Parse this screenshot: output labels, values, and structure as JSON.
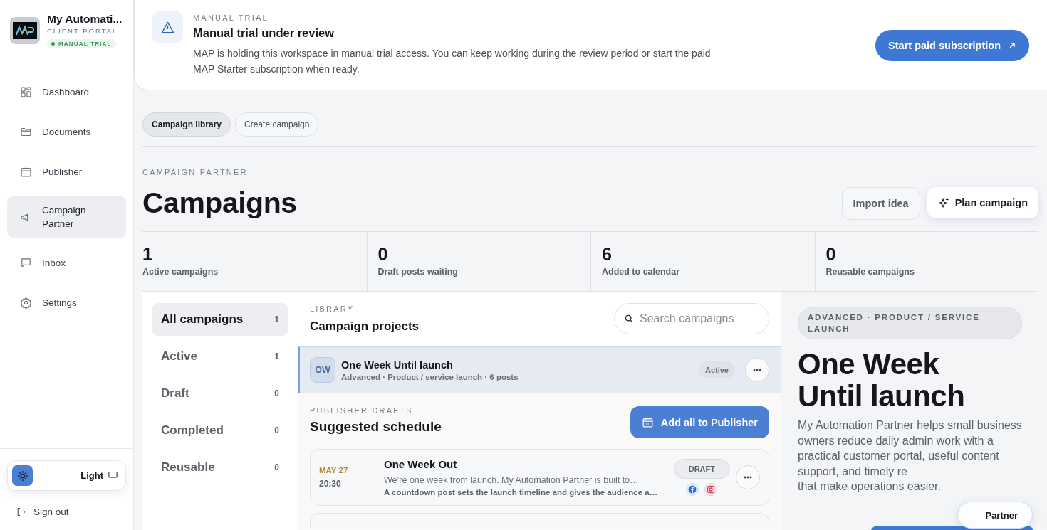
{
  "sidebar": {
    "brand": {
      "name": "My Automati...",
      "subtitle": "CLIENT PORTAL",
      "badge": "MANUAL TRIAL"
    },
    "nav": [
      {
        "label": "Dashboard",
        "selected": false
      },
      {
        "label": "Documents",
        "selected": false
      },
      {
        "label": "Publisher",
        "selected": false
      },
      {
        "label": "Campaign Partner",
        "selected": true
      },
      {
        "label": "Inbox",
        "selected": false
      },
      {
        "label": "Settings",
        "selected": false
      }
    ],
    "theme": {
      "label": "Light"
    },
    "sign_out": "Sign out"
  },
  "banner": {
    "eyebrow": "MANUAL TRIAL",
    "title": "Manual trial under review",
    "text": "MAP is holding this workspace in manual trial access. You can keep working during the review period or start the paid MAP Starter subscription when ready.",
    "button": "Start paid subscription"
  },
  "tabs": [
    {
      "label": "Campaign library",
      "selected": true
    },
    {
      "label": "Create campaign",
      "selected": false
    }
  ],
  "header": {
    "eyebrow": "CAMPAIGN PARTNER",
    "title": "Campaigns",
    "buttons": [
      {
        "label": "Import idea",
        "kind": "secondary"
      },
      {
        "label": "Plan campaign",
        "kind": "sparkle"
      }
    ]
  },
  "stats": [
    {
      "value": "1",
      "label": "Active campaigns"
    },
    {
      "value": "0",
      "label": "Draft posts waiting"
    },
    {
      "value": "6",
      "label": "Added to calendar"
    },
    {
      "value": "0",
      "label": "Reusable campaigns"
    }
  ],
  "filters": [
    {
      "label": "All campaigns",
      "count": "1",
      "selected": true
    },
    {
      "label": "Active",
      "count": "1",
      "selected": false
    },
    {
      "label": "Draft",
      "count": "0",
      "selected": false
    },
    {
      "label": "Completed",
      "count": "0",
      "selected": false
    },
    {
      "label": "Reusable",
      "count": "0",
      "selected": false
    }
  ],
  "library": {
    "eyebrow": "LIBRARY",
    "title": "Campaign projects",
    "search_placeholder": "Search campaigns",
    "projects": [
      {
        "initials": "OW",
        "title": "One Week Until launch",
        "meta": "Advanced · Product / service launch · 6 posts",
        "status": "Active",
        "selected": true
      }
    ]
  },
  "drafts": {
    "eyebrow": "PUBLISHER DRAFTS",
    "title": "Suggested schedule",
    "button": "Add all to Publisher",
    "items": [
      {
        "date": "MAY 27",
        "time": "20:30",
        "title": "One Week Out",
        "text": "We’re one week from launch. My Automation Partner is built to…",
        "note": "A countdown post sets the launch timeline and gives the audience a…",
        "status": "DRAFT",
        "channels": [
          {
            "kind": "facebook"
          },
          {
            "kind": "instagram"
          }
        ]
      }
    ]
  },
  "detail": {
    "tag": "ADVANCED · PRODUCT / SERVICE LAUNCH",
    "title": "One Week Until launch",
    "description": "My Automation Partner helps small business owners reduce daily admin work with a practical customer portal, useful content support, and timely re",
    "description_end": "that make operations easier."
  },
  "float_button": {
    "label": "Partner"
  }
}
